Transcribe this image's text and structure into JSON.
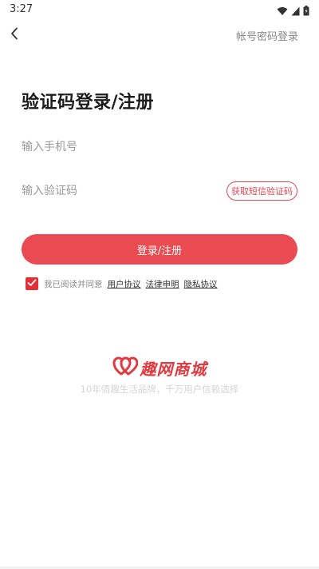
{
  "status_bar": {
    "time": "3:27",
    "icons": [
      "wifi-icon",
      "signal-icon",
      "battery-icon"
    ]
  },
  "nav": {
    "back_icon": "chevron-left-icon",
    "account_login_label": "帐号密码登录"
  },
  "title": "验证码登录/注册",
  "phone_input": {
    "placeholder": "输入手机号",
    "value": ""
  },
  "code_input": {
    "placeholder": "输入验证码",
    "value": ""
  },
  "get_code_label": "获取短信验证码",
  "login_button_label": "登录/注册",
  "agreement": {
    "checked": true,
    "prefix": "我已阅读并同意",
    "links": [
      "用户协议",
      "法律申明",
      "隐私协议"
    ]
  },
  "brand": {
    "name": "趣网商城",
    "slogan": "10年情趣生活品牌，千万用户信赖选择",
    "logo_icon": "double-heart-logo-icon"
  },
  "colors": {
    "accent": "#ea4b52",
    "checkbox": "#e42f38",
    "brand": "#e23a41",
    "placeholder": "#9a9a9a"
  }
}
